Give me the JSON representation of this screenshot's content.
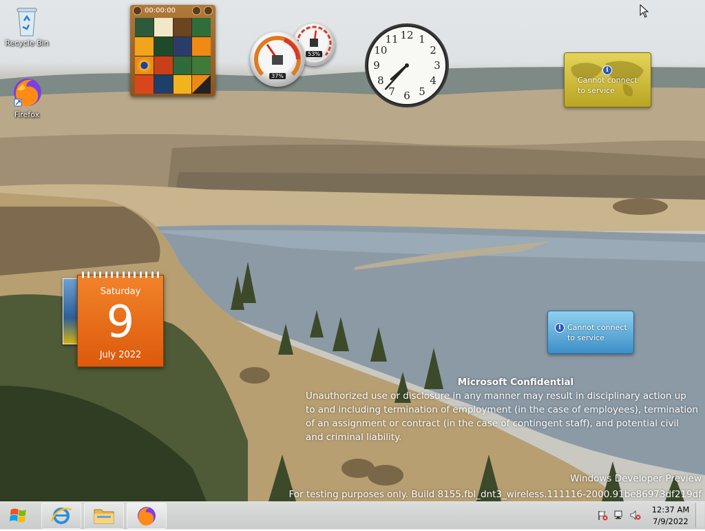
{
  "desktop": {
    "icons": [
      {
        "label": "Recycle Bin",
        "icon": "recycle-bin-icon"
      },
      {
        "label": "Firefox",
        "icon": "firefox-icon"
      }
    ]
  },
  "gadgets": {
    "puzzle": {
      "timer": "00:00:00"
    },
    "cpu_meter": {
      "cpu_percent": "37%",
      "memory_percent": "53%",
      "cpu_value": 0.37,
      "memory_value": 0.53
    },
    "clock": {
      "hour": 7,
      "minute": 37
    },
    "weather": {
      "message": "Cannot connect to service",
      "line1": "Cannot connect",
      "line2": "to service"
    },
    "feed": {
      "message": "Cannot connect to service",
      "line1": "Cannot connect",
      "line2": "to service"
    },
    "calendar": {
      "weekday": "Saturday",
      "day": "9",
      "month_year": "July 2022"
    }
  },
  "watermark": {
    "title": "Microsoft Confidential",
    "body": "Unauthorized use or disclosure in any manner may result in disciplinary action up to and including termination of employment (in the case of employees), termination of an assignment or contract (in the case of contingent staff), and potential civil and criminal liability.",
    "edition": "Windows Developer Preview",
    "build": "For testing purposes only. Build 8155.fbl_dnt3_wireless.111116-2000.91be86973df219df"
  },
  "taskbar": {
    "start": "start-orb-icon",
    "pinned": [
      {
        "name": "Internet Explorer",
        "icon": "internet-explorer-icon"
      },
      {
        "name": "File Explorer",
        "icon": "folder-icon"
      },
      {
        "name": "Firefox",
        "icon": "firefox-icon",
        "active": true
      }
    ],
    "tray": {
      "icons": [
        "action-center-flag-icon",
        "network-icon",
        "volume-muted-icon"
      ],
      "time": "12:37 AM",
      "date": "7/9/2022"
    }
  },
  "colors": {
    "calendar_orange": "#e8701a",
    "weather_gold": "#cdbb33",
    "feed_blue": "#5aa6d8"
  }
}
